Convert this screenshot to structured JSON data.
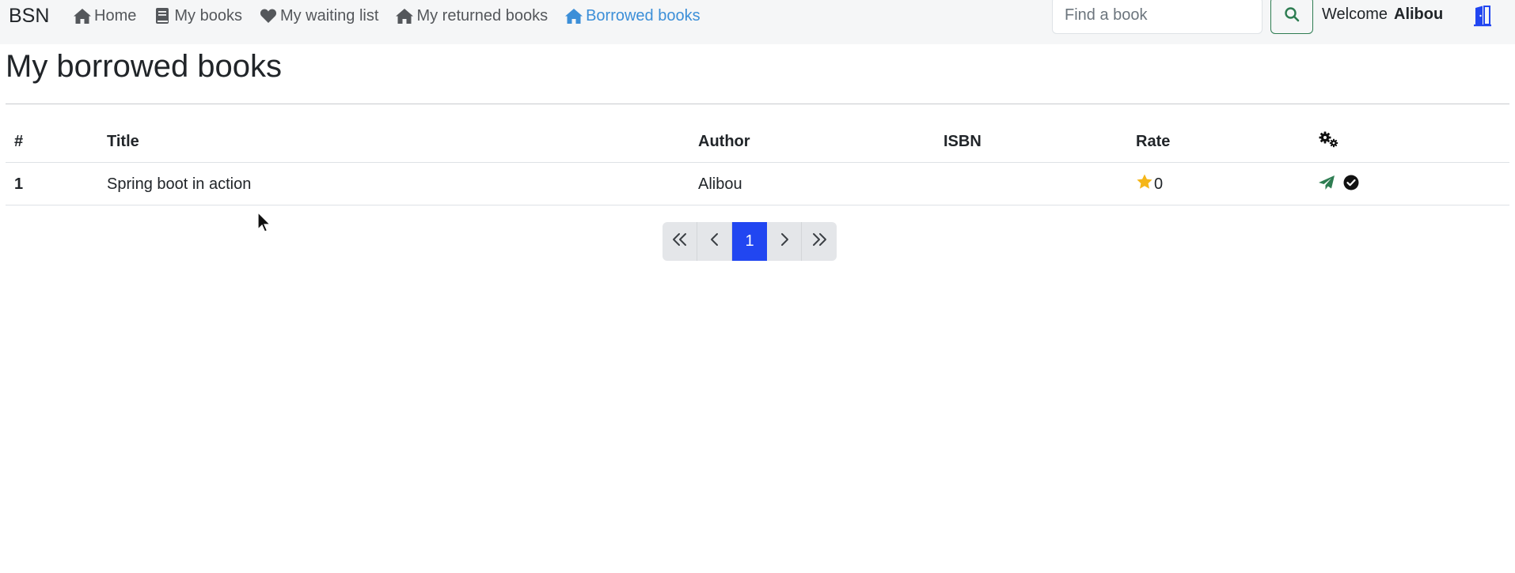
{
  "navbar": {
    "brand": "BSN",
    "links": [
      {
        "label": "Home",
        "icon": "home-icon",
        "active": false
      },
      {
        "label": "My books",
        "icon": "book-icon",
        "active": false
      },
      {
        "label": "My waiting list",
        "icon": "heart-icon",
        "active": false
      },
      {
        "label": "My returned books",
        "icon": "home-icon",
        "active": false
      },
      {
        "label": "Borrowed books",
        "icon": "home-icon",
        "active": true
      }
    ],
    "search": {
      "placeholder": "Find a book",
      "value": ""
    },
    "welcome_label": "Welcome",
    "username": "Alibou"
  },
  "page": {
    "title": "My borrowed books"
  },
  "table": {
    "headers": {
      "num": "#",
      "title": "Title",
      "author": "Author",
      "isbn": "ISBN",
      "rate": "Rate",
      "actions_icon": "gears-icon"
    },
    "rows": [
      {
        "num": "1",
        "title": "Spring boot in action",
        "author": "Alibou",
        "isbn": "",
        "rate": "0",
        "actions": [
          "paper-plane-icon",
          "check-circle-icon"
        ]
      }
    ]
  },
  "pagination": {
    "first": "«",
    "prev": "‹",
    "current": "1",
    "next": "›",
    "last": "»"
  },
  "colors": {
    "navbar_bg": "#f5f6f7",
    "active_link": "#3c8fd8",
    "page_active": "#2146f1",
    "search_border": "#2e7d52",
    "star": "#f5b619",
    "plane": "#2e7d52",
    "logout": "#2146f1"
  }
}
